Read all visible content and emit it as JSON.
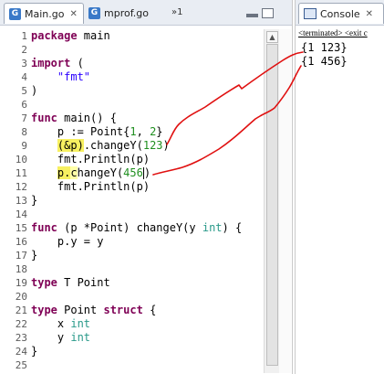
{
  "editor": {
    "tabs": [
      {
        "label": "Main.go",
        "icon": "go-file-icon",
        "active": true
      },
      {
        "label": "mprof.go",
        "icon": "go-file-icon",
        "active": false
      }
    ],
    "overflow_label": "»1",
    "lines": [
      {
        "n": "1"
      },
      {
        "n": "2"
      },
      {
        "n": "3"
      },
      {
        "n": "4"
      },
      {
        "n": "5"
      },
      {
        "n": "6"
      },
      {
        "n": "7"
      },
      {
        "n": "8"
      },
      {
        "n": "9"
      },
      {
        "n": "10"
      },
      {
        "n": "11"
      },
      {
        "n": "12"
      },
      {
        "n": "13"
      },
      {
        "n": "14"
      },
      {
        "n": "15"
      },
      {
        "n": "16"
      },
      {
        "n": "17"
      },
      {
        "n": "18"
      },
      {
        "n": "19"
      },
      {
        "n": "20"
      },
      {
        "n": "21"
      },
      {
        "n": "22"
      },
      {
        "n": "23"
      },
      {
        "n": "24"
      },
      {
        "n": "25"
      }
    ],
    "code": {
      "l1_kw": "package",
      "l1_rest": " main",
      "l3_kw": "import",
      "l3_rest": " (",
      "l4_str": "\"fmt\"",
      "l5": ")",
      "l7_kw": "func",
      "l7_rest": " main() {",
      "l8_a": "    p := Point{",
      "l8_n1": "1",
      "l8_b": ", ",
      "l8_n2": "2",
      "l8_c": "}",
      "l9_hl": "(&p)",
      "l9_rest": ".changeY(",
      "l9_num": "123",
      "l9_end": ")",
      "l10": "    fmt.Println(p)",
      "l11_hl1": "p.",
      "l11_hl2": "c",
      "l11_rest": "hangeY(",
      "l11_num": "456",
      "l11_end": ")",
      "l12": "    fmt.Println(p)",
      "l13": "}",
      "l15_kw": "func",
      "l15_a": " (p *Point) changeY(y ",
      "l15_type": "int",
      "l15_b": ") {",
      "l16": "    p.y = y",
      "l17": "}",
      "l19_kw": "type",
      "l19_rest": " T Point",
      "l21_kw1": "type",
      "l21_a": " Point ",
      "l21_kw2": "struct",
      "l21_b": " {",
      "l22_a": "    x ",
      "l22_type": "int",
      "l23_a": "    y ",
      "l23_type": "int",
      "l24": "}"
    }
  },
  "console": {
    "tab_label": "Console",
    "status": "<terminated> <exit c",
    "output": [
      "{1 123}",
      "{1 456}"
    ]
  },
  "colors": {
    "keyword": "#7f0055",
    "string": "#2a00ff",
    "type": "#2a9a8a",
    "number": "#1f8f1f",
    "highlight": "#f7f060",
    "annotation_ink": "#e01010"
  }
}
